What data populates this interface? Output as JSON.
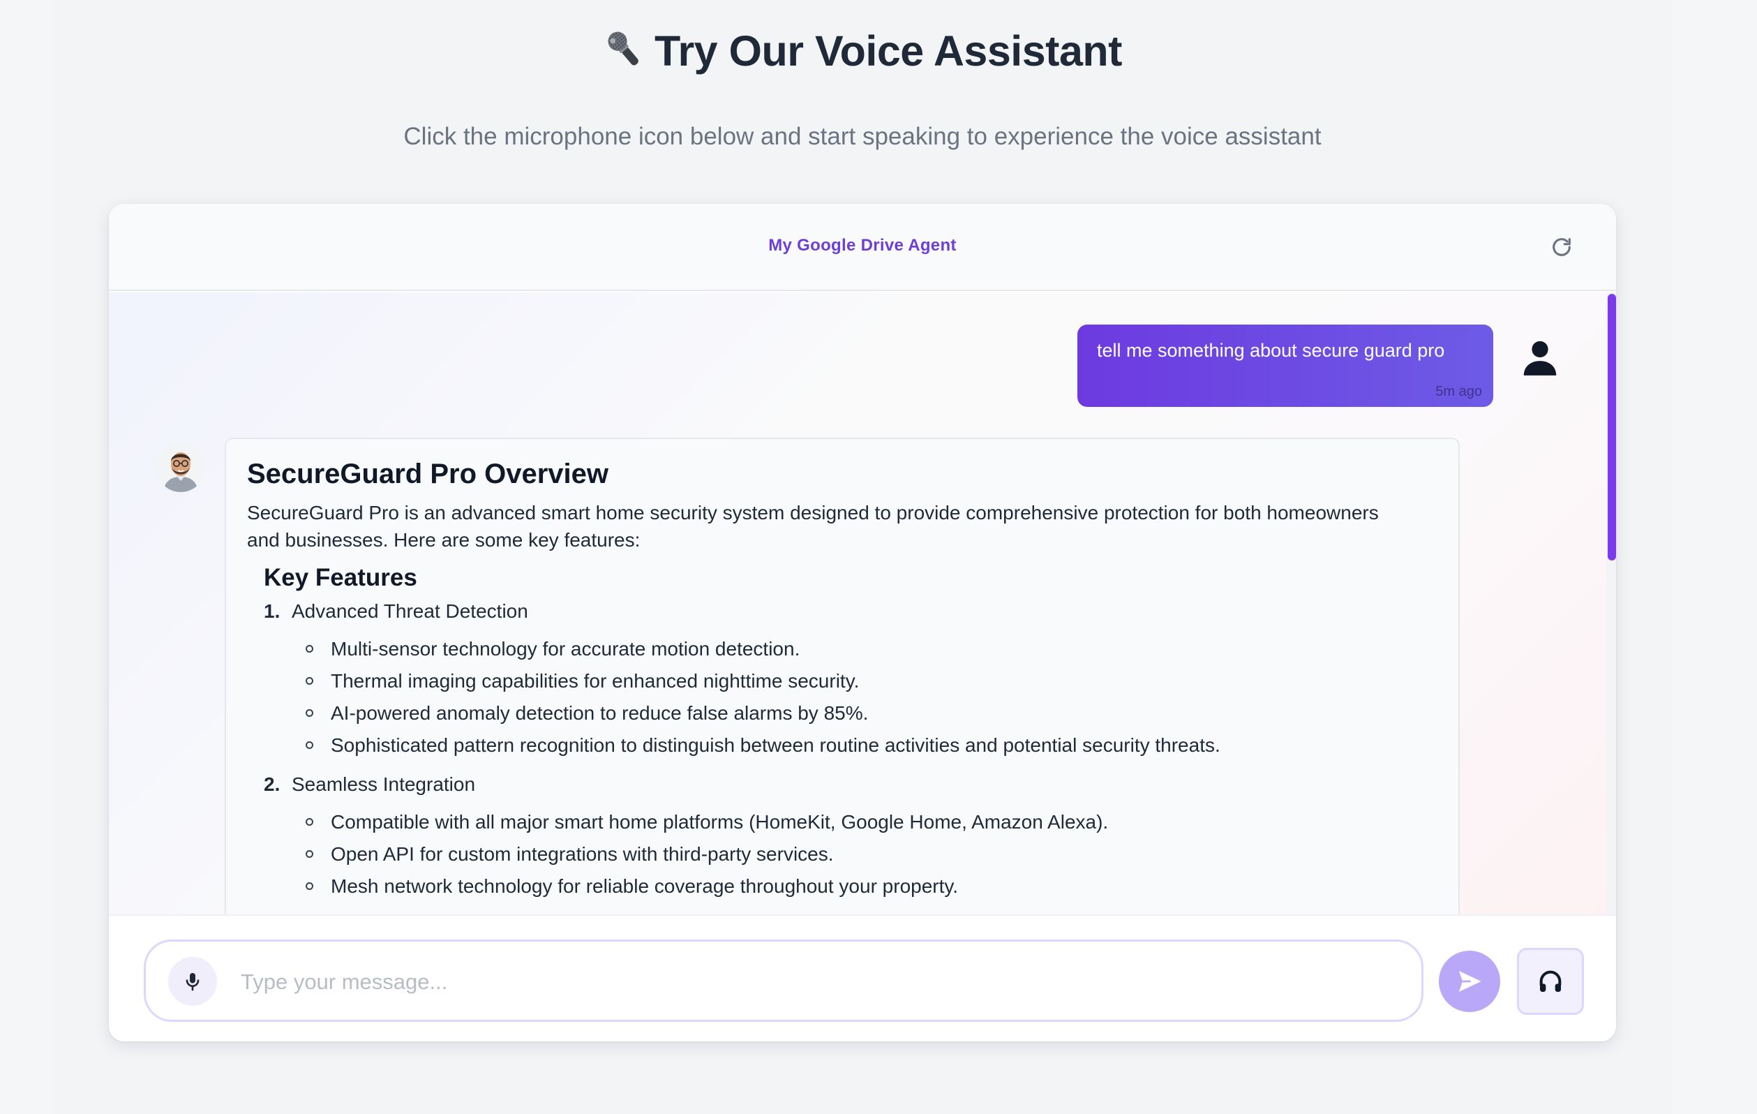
{
  "page": {
    "title": "Try Our Voice Assistant",
    "subtitle": "Click the microphone icon below and start speaking to experience the voice assistant"
  },
  "chat": {
    "agent_name": "My Google Drive Agent",
    "user_message": {
      "text": "tell me something about secure guard pro",
      "time": "5m ago"
    },
    "bot_message": {
      "title": "SecureGuard Pro Overview",
      "intro": "SecureGuard Pro is an advanced smart home security system designed to provide comprehensive protection for both homeowners and businesses. Here are some key features:",
      "section_title": "Key Features",
      "features": [
        {
          "number": "1.",
          "label": "Advanced Threat Detection",
          "items": [
            "Multi-sensor technology for accurate motion detection.",
            "Thermal imaging capabilities for enhanced nighttime security.",
            "AI-powered anomaly detection to reduce false alarms by 85%.",
            "Sophisticated pattern recognition to distinguish between routine activities and potential security threats."
          ]
        },
        {
          "number": "2.",
          "label": "Seamless Integration",
          "items": [
            "Compatible with all major smart home platforms (HomeKit, Google Home, Amazon Alexa).",
            "Open API for custom integrations with third-party services.",
            "Mesh network technology for reliable coverage throughout your property."
          ]
        }
      ]
    }
  },
  "composer": {
    "placeholder": "Type your message...",
    "value": ""
  },
  "icons": {
    "title_icon": "microphone-emoji-icon",
    "refresh": "refresh-icon",
    "user_avatar": "person-icon",
    "bot_avatar": "bot-avatar-photo",
    "mic": "microphone-icon",
    "send": "send-icon",
    "headset": "headphones-icon"
  },
  "colors": {
    "accent": "#7c3aed",
    "agent_name": "#6d3fd8",
    "send_button": "#b9a8f7",
    "input_border": "#ddd6fe"
  }
}
